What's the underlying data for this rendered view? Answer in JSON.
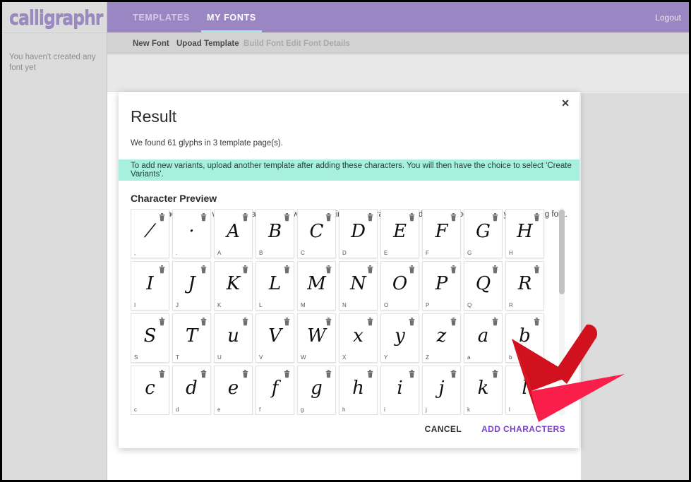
{
  "app": {
    "logo_text": "calligraphr",
    "sidebar_empty_message": "You haven't created any font yet"
  },
  "topnav": {
    "tabs": [
      {
        "label": "TEMPLATES",
        "active": false
      },
      {
        "label": "MY FONTS",
        "active": true
      }
    ],
    "logout_label": "Logout"
  },
  "subnav": {
    "items": [
      {
        "label": "New Font",
        "enabled": true
      },
      {
        "label": "Upoad Template",
        "enabled": true
      },
      {
        "label": "Build Font",
        "enabled": false
      },
      {
        "label": "Edit Font Details",
        "enabled": false
      }
    ]
  },
  "modal": {
    "title": "Result",
    "close_icon": "close-icon",
    "subtitle": "We found 61 glyphs in 3 template page(s).",
    "notice": "To add new variants, upload another template after adding these characters. You will then have the choice to select 'Create Variants'.",
    "preview_heading": "Character Preview",
    "preview_hint": "If you are not satisfied with a character, remove it by clicking on the trash can and it will not be added to your existing font.",
    "glyph_count": 61,
    "template_pages": 3,
    "cells": [
      {
        "label": ",",
        "glyph": "⁄"
      },
      {
        "label": ".",
        "glyph": "·"
      },
      {
        "label": "A",
        "glyph": "A"
      },
      {
        "label": "B",
        "glyph": "B"
      },
      {
        "label": "C",
        "glyph": "C"
      },
      {
        "label": "D",
        "glyph": "D"
      },
      {
        "label": "E",
        "glyph": "E"
      },
      {
        "label": "F",
        "glyph": "F"
      },
      {
        "label": "G",
        "glyph": "G"
      },
      {
        "label": "H",
        "glyph": "H"
      },
      {
        "label": "I",
        "glyph": "I"
      },
      {
        "label": "J",
        "glyph": "J"
      },
      {
        "label": "K",
        "glyph": "K"
      },
      {
        "label": "L",
        "glyph": "L"
      },
      {
        "label": "M",
        "glyph": "M"
      },
      {
        "label": "N",
        "glyph": "N"
      },
      {
        "label": "O",
        "glyph": "O"
      },
      {
        "label": "P",
        "glyph": "P"
      },
      {
        "label": "Q",
        "glyph": "Q"
      },
      {
        "label": "R",
        "glyph": "R"
      },
      {
        "label": "S",
        "glyph": "S"
      },
      {
        "label": "T",
        "glyph": "T"
      },
      {
        "label": "U",
        "glyph": "u"
      },
      {
        "label": "V",
        "glyph": "V"
      },
      {
        "label": "W",
        "glyph": "W"
      },
      {
        "label": "X",
        "glyph": "x"
      },
      {
        "label": "Y",
        "glyph": "y"
      },
      {
        "label": "Z",
        "glyph": "z"
      },
      {
        "label": "a",
        "glyph": "a"
      },
      {
        "label": "b",
        "glyph": "b"
      },
      {
        "label": "c",
        "glyph": "c"
      },
      {
        "label": "d",
        "glyph": "d"
      },
      {
        "label": "e",
        "glyph": "e"
      },
      {
        "label": "f",
        "glyph": "f"
      },
      {
        "label": "g",
        "glyph": "g"
      },
      {
        "label": "h",
        "glyph": "h"
      },
      {
        "label": "i",
        "glyph": "i"
      },
      {
        "label": "j",
        "glyph": "j"
      },
      {
        "label": "k",
        "glyph": "k"
      },
      {
        "label": "l",
        "glyph": "l"
      }
    ],
    "cancel_label": "CANCEL",
    "add_label": "ADD CHARACTERS"
  },
  "annotation": {
    "arrow_name": "red-arrow-pointer",
    "arrow_color_dark": "#d1111e",
    "arrow_color_light": "#fa1f4b",
    "points_at": "ADD CHARACTERS"
  },
  "colors": {
    "topbar_purple": "#9b86c4",
    "accent_teal": "#a8e8e0",
    "notice_bg": "#a7f0e0",
    "link_purple": "#7b3fd4",
    "sidebar_gray": "#dcdcdc"
  }
}
